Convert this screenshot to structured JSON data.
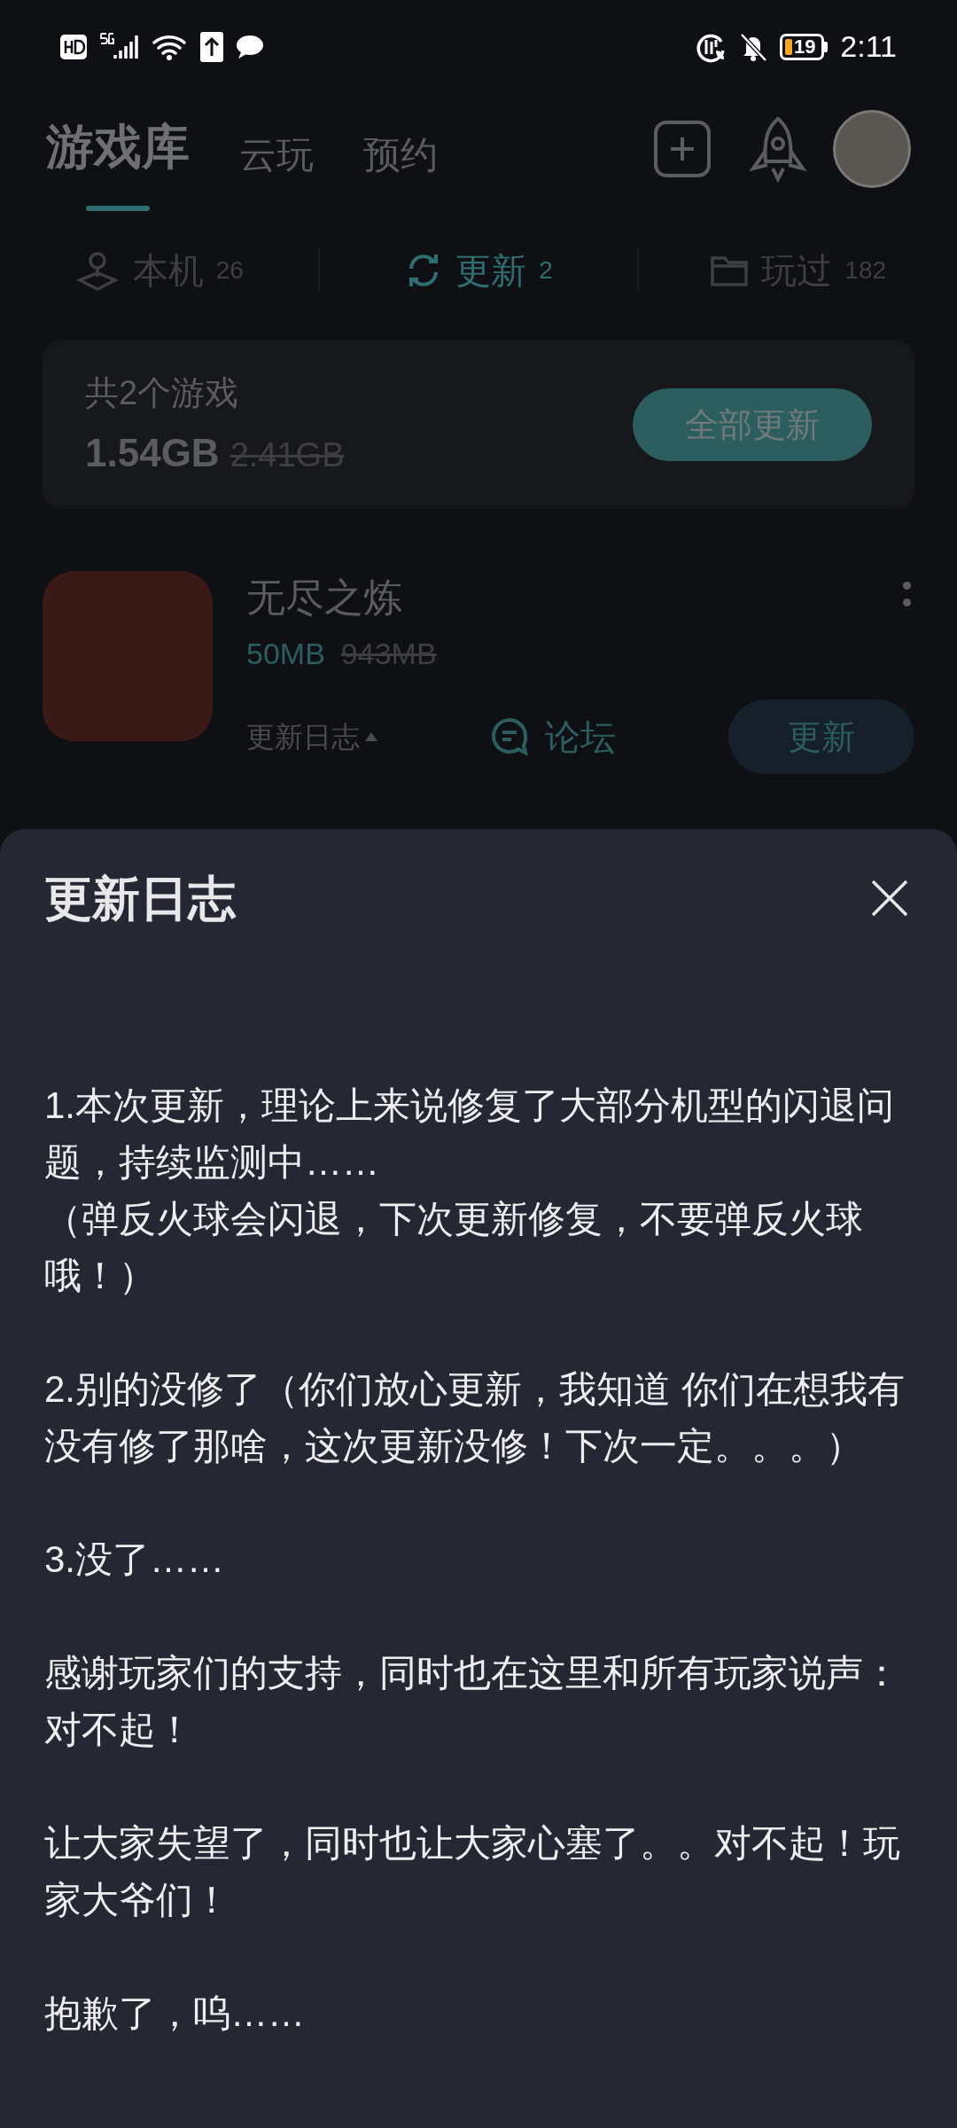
{
  "status_bar": {
    "time": "2:11",
    "battery": "19"
  },
  "top_tabs": [
    {
      "label": "游戏库",
      "selected": true
    },
    {
      "label": "云玩",
      "selected": false
    },
    {
      "label": "预约",
      "selected": false
    }
  ],
  "sub_tabs": [
    {
      "kind": "device",
      "label": "本机",
      "count": "26",
      "selected": false
    },
    {
      "kind": "update",
      "label": "更新",
      "count": "2",
      "selected": true
    },
    {
      "kind": "played",
      "label": "玩过",
      "count": "182",
      "selected": false
    }
  ],
  "summary": {
    "title": "共2个游戏",
    "size": "1.54GB",
    "original_size": "2.41GB",
    "button": "全部更新"
  },
  "games": [
    {
      "name": "无尽之炼",
      "size": "50MB",
      "original_size": "943MB",
      "log_label": "更新日志",
      "forum": "论坛",
      "button": "更新"
    }
  ],
  "sheet": {
    "title": "更新日志",
    "paragraphs": [
      "1.本次更新，理论上来说修复了大部分机型的闪退问题，持续监测中……\n（弹反火球会闪退，下次更新修复，不要弹反火球哦！）",
      "2.别的没修了（你们放心更新，我知道 你们在想我有没有修了那啥，这次更新没修！下次一定。。。）",
      "3.没了……",
      "感谢玩家们的支持，同时也在这里和所有玩家说声：对不起！",
      "让大家失望了，同时也让大家心塞了。。对不起！玩家大爷们！",
      "抱歉了，呜……"
    ]
  }
}
